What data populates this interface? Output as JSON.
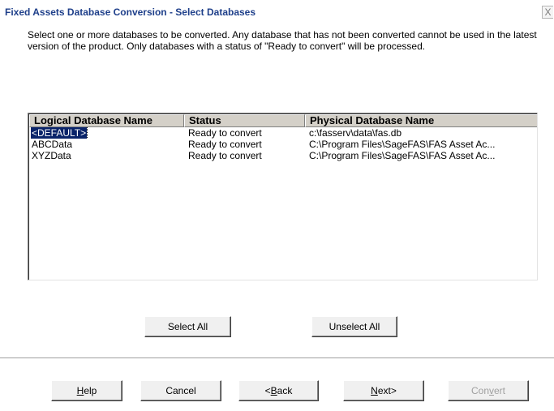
{
  "window": {
    "title": "Fixed Assets Database Conversion - Select Databases",
    "close_glyph": "X"
  },
  "intro_text": "Select one or more databases to be converted. Any database that has not been converted cannot be used in the latest version of the product. Only databases with a status of \"Ready to convert\" will be processed.",
  "table": {
    "columns": [
      "Logical Database Name",
      "Status",
      "Physical Database Name"
    ],
    "rows": [
      {
        "logical": "<DEFAULT>",
        "status": "Ready to convert",
        "physical": "c:\\fasserv\\data\\fas.db",
        "selected": true
      },
      {
        "logical": "ABCData",
        "status": "Ready to convert",
        "physical": "C:\\Program Files\\SageFAS\\FAS Asset Ac...",
        "selected": false
      },
      {
        "logical": "XYZData",
        "status": "Ready to convert",
        "physical": "C:\\Program Files\\SageFAS\\FAS Asset Ac...",
        "selected": false
      }
    ]
  },
  "buttons": {
    "select_all": "Select All",
    "unselect_all": "Unselect All",
    "help_pre": "",
    "help_mn": "H",
    "help_post": "elp",
    "cancel": "Cancel",
    "back_pre": "<",
    "back_mn": "B",
    "back_post": "ack",
    "next_pre": "",
    "next_mn": "N",
    "next_post": "ext>",
    "convert_pre": "Con",
    "convert_mn": "v",
    "convert_post": "ert"
  },
  "colors": {
    "title": "#1e3f8a",
    "selection": "#0a246a",
    "header_bg": "#d4d0c8",
    "disabled_text": "#a0a0a0"
  }
}
